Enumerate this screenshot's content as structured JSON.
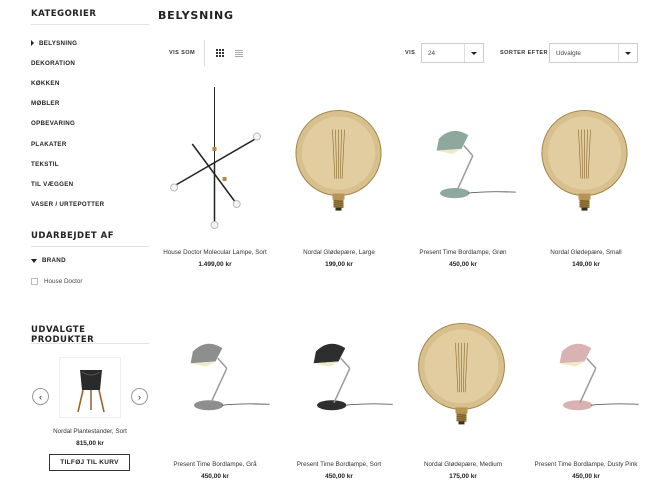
{
  "sidebar": {
    "categories_heading": "KATEGORIER",
    "categories": [
      "BELYSNING",
      "DEKORATION",
      "KØKKEN",
      "MØBLER",
      "OPBEVARING",
      "PLAKATER",
      "TEKSTIL",
      "TIL VÆGGEN",
      "VASER / URTEPOTTER"
    ],
    "made_by_heading": "UDARBEJDET AF",
    "brand_label": "BRAND",
    "brand_option": "House Doctor",
    "selected_heading": "UDVALGTE PRODUKTER",
    "selected_product": {
      "name": "Nordal Plantestander, Sort",
      "price": "815,00 kr",
      "cart_label": "TILFØJ TIL KURV"
    },
    "prev_icon": "chevron-left-icon",
    "next_icon": "chevron-right-icon"
  },
  "main": {
    "title": "BELYSNING",
    "view_label": "VIS SOM",
    "show_label": "VIS",
    "show_value": "24",
    "sort_label": "SORTER EFTER",
    "sort_value": "Udvalgte",
    "view_icons": [
      "grid-view-icon",
      "list-view-icon"
    ]
  },
  "products": [
    {
      "name": "House Doctor Molecular Lampe, Sort",
      "price": "1.499,00 kr",
      "image": "molecular-pendant"
    },
    {
      "name": "Nordal Glødepære, Large",
      "price": "199,00 kr",
      "image": "globe-bulb"
    },
    {
      "name": "Present Time Bordlampe, Grøn",
      "price": "450,00 kr",
      "image": "desk-lamp",
      "color": "#8fa89e"
    },
    {
      "name": "Nordal Glødepære, Small",
      "price": "149,00 kr",
      "image": "globe-bulb"
    },
    {
      "name": "Present Time Bordlampe, Grå",
      "price": "450,00 kr",
      "image": "desk-lamp",
      "color": "#8d8f8e"
    },
    {
      "name": "Present Time Bordlampe, Sort",
      "price": "450,00 kr",
      "image": "desk-lamp",
      "color": "#2d2e2e"
    },
    {
      "name": "Nordal Glødepære, Medium",
      "price": "175,00 kr",
      "image": "globe-bulb"
    },
    {
      "name": "Present Time Bordlampe, Dusty Pink",
      "price": "450,00 kr",
      "image": "desk-lamp",
      "color": "#d9b3b3"
    }
  ]
}
